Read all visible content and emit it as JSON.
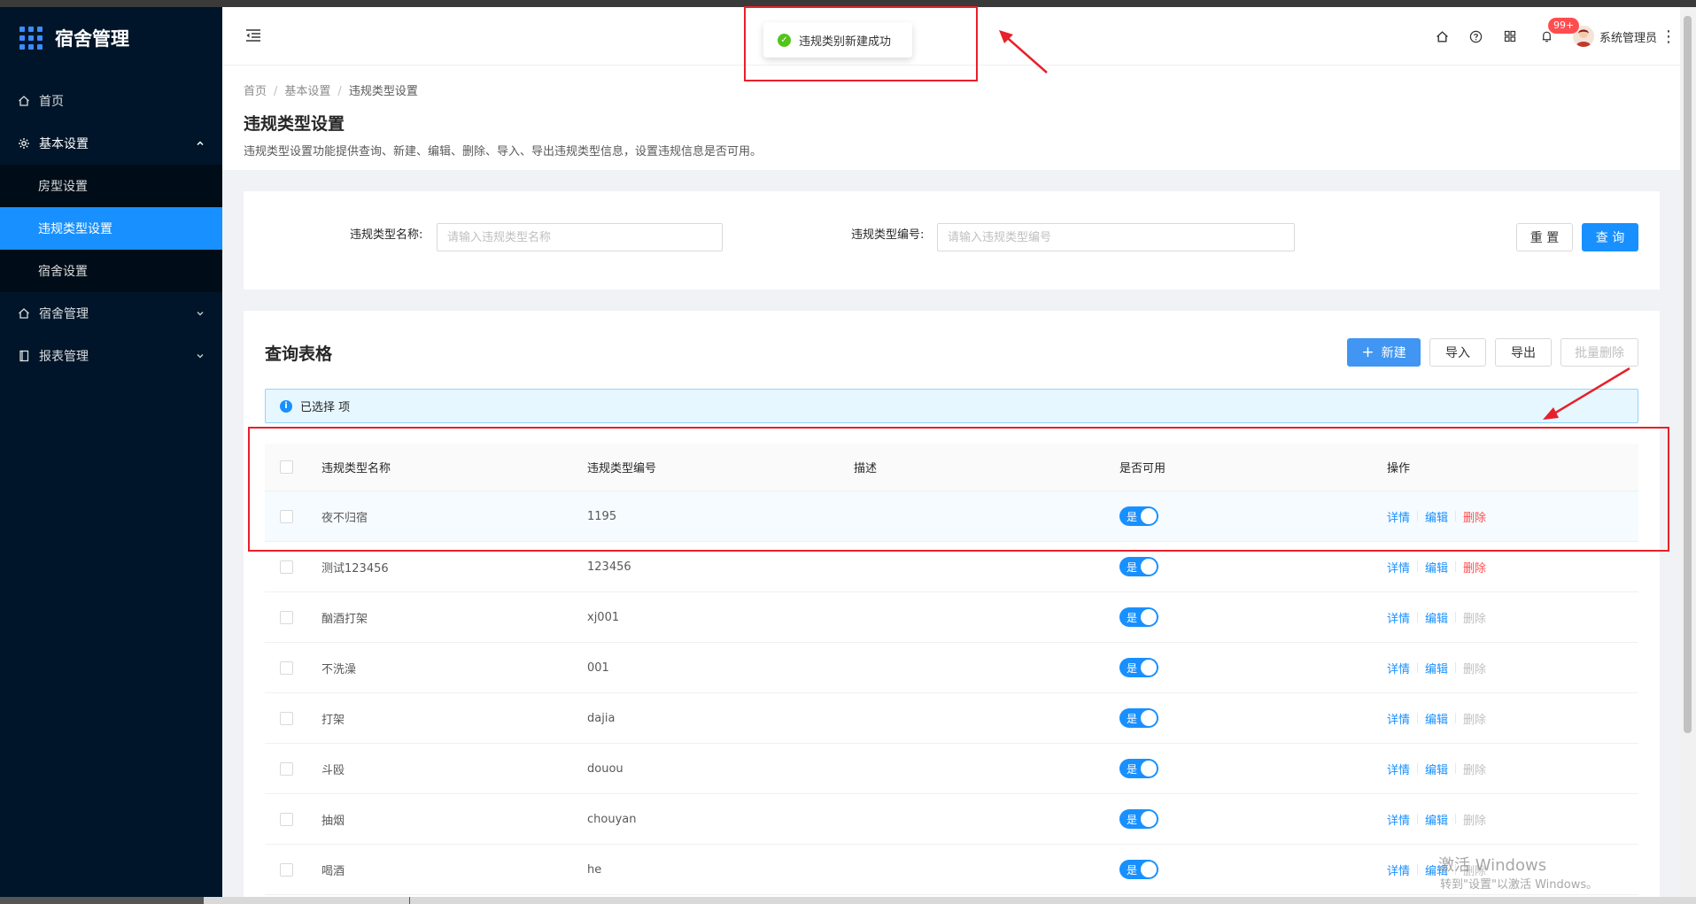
{
  "app": {
    "title": "宿舍管理"
  },
  "sidebar": {
    "items": [
      {
        "label": "首页",
        "icon": "home-icon"
      },
      {
        "label": "基本设置",
        "icon": "gear-icon",
        "open": true,
        "children": [
          {
            "label": "房型设置"
          },
          {
            "label": "违规类型设置",
            "active": true
          },
          {
            "label": "宿舍设置"
          }
        ]
      },
      {
        "label": "宿舍管理",
        "icon": "home-icon"
      },
      {
        "label": "报表管理",
        "icon": "book-icon"
      }
    ]
  },
  "header": {
    "badge": "99+",
    "user": "系统管理员",
    "icons": [
      "home-icon",
      "help-icon",
      "apps-icon",
      "bell-icon",
      "more-icon"
    ]
  },
  "toast": {
    "message": "违规类别新建成功",
    "type": "success"
  },
  "breadcrumb": [
    "首页",
    "基本设置",
    "违规类型设置"
  ],
  "page": {
    "title": "违规类型设置",
    "description": "违规类型设置功能提供查询、新建、编辑、删除、导入、导出违规类型信息，设置违规信息是否可用。"
  },
  "search": {
    "name_label": "违规类型名称:",
    "name_placeholder": "请输入违规类型名称",
    "code_label": "违规类型编号:",
    "code_placeholder": "请输入违规类型编号",
    "reset": "重 置",
    "query": "查 询"
  },
  "table_section": {
    "title": "查询表格",
    "buttons": {
      "new": "新建",
      "import": "导入",
      "export": "导出",
      "batch_delete": "批量删除"
    },
    "alert": "已选择 项",
    "columns": [
      "违规类型名称",
      "违规类型编号",
      "描述",
      "是否可用",
      "操作"
    ],
    "rows": [
      {
        "name": "夜不归宿",
        "code": "1195",
        "desc": "",
        "enabled": "是",
        "delete_enabled": true
      },
      {
        "name": "测试123456",
        "code": "123456",
        "desc": "",
        "enabled": "是",
        "delete_enabled": true
      },
      {
        "name": "酗酒打架",
        "code": "xj001",
        "desc": "",
        "enabled": "是",
        "delete_enabled": false
      },
      {
        "name": "不洗澡",
        "code": "001",
        "desc": "",
        "enabled": "是",
        "delete_enabled": false
      },
      {
        "name": "打架",
        "code": "dajia",
        "desc": "",
        "enabled": "是",
        "delete_enabled": false
      },
      {
        "name": "斗殴",
        "code": "douou",
        "desc": "",
        "enabled": "是",
        "delete_enabled": false
      },
      {
        "name": "抽烟",
        "code": "chouyan",
        "desc": "",
        "enabled": "是",
        "delete_enabled": false
      },
      {
        "name": "喝酒",
        "code": "he",
        "desc": "",
        "enabled": "是",
        "delete_enabled": false
      }
    ],
    "actions": {
      "detail": "详情",
      "edit": "编辑",
      "delete": "删除"
    }
  },
  "watermark": {
    "line1": "激活 Windows",
    "line2": "转到\"设置\"以激活 Windows。"
  },
  "colors": {
    "primary": "#1890ff",
    "sidebar": "#001529",
    "danger": "#ff4d4f",
    "annotation": "#e8202a"
  }
}
